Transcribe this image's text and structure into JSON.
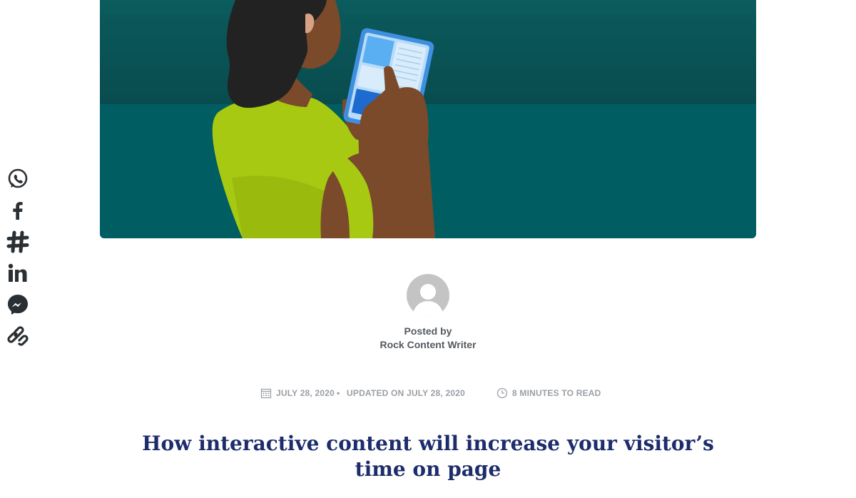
{
  "share": {
    "items": [
      {
        "name": "whatsapp-icon"
      },
      {
        "name": "facebook-icon"
      },
      {
        "name": "slack-icon"
      },
      {
        "name": "linkedin-icon"
      },
      {
        "name": "messenger-icon"
      },
      {
        "name": "copy-link-icon"
      }
    ]
  },
  "colors": {
    "hero_bg_top": "#0a5153",
    "hero_bg_bottom": "#005e63",
    "shirt": "#a8c912",
    "skin": "#7a4a2a",
    "hair": "#222222",
    "title": "#1d2c6b",
    "meta": "#9a9fa4"
  },
  "author": {
    "posted_by_label": "Posted by",
    "name": "Rock Content Writer"
  },
  "meta": {
    "date": "JULY 28, 2020",
    "separator": "•",
    "updated": "UPDATED ON JULY 28, 2020",
    "read_time": "8 MINUTES TO READ"
  },
  "article": {
    "title": "How interactive content will increase your visitor’s time on page"
  }
}
